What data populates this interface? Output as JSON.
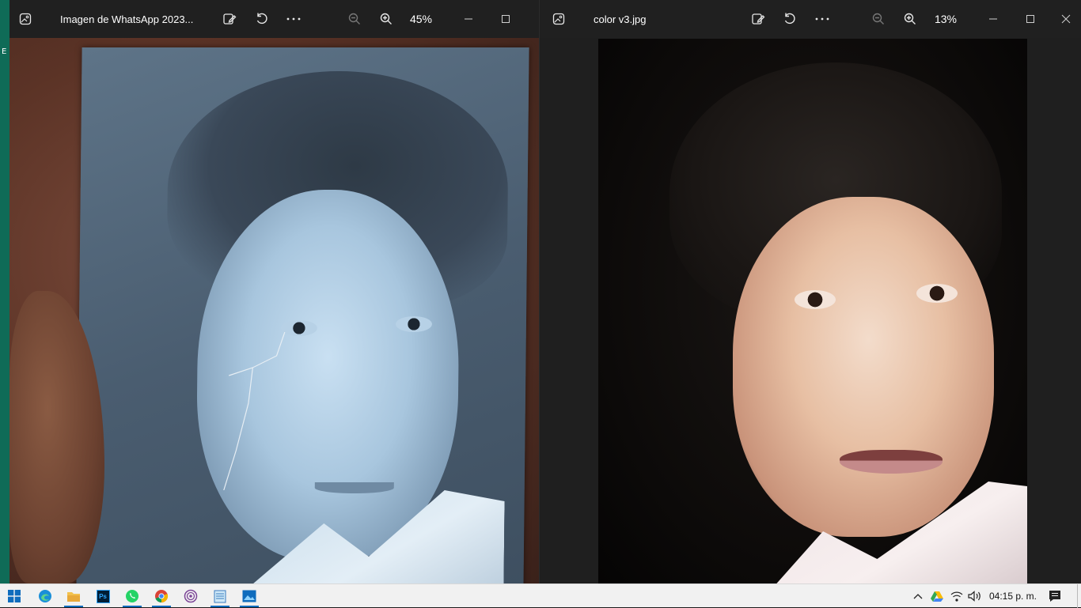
{
  "left_window": {
    "title": "Imagen de WhatsApp 2023...",
    "zoom": "45%"
  },
  "right_window": {
    "title": "color v3.jpg",
    "zoom": "13%"
  },
  "desktop_edge_text": "E",
  "taskbar": {
    "apps": [
      "start-icon",
      "edge-icon",
      "file-explorer-icon",
      "photoshop-icon",
      "whatsapp-icon",
      "chrome-icon",
      "tor-browser-icon",
      "notepad-icon",
      "photos-icon"
    ],
    "photoshop_label": "Ps",
    "clock": "04:15 p. m."
  },
  "colors": {
    "titlebar": "#202020",
    "taskbar": "#f1f1f1",
    "accent": "#0f6cbd"
  }
}
